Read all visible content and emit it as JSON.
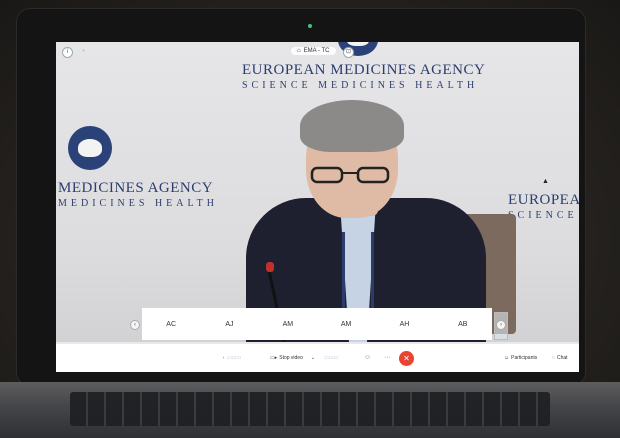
{
  "meeting": {
    "title": "EMA - TC",
    "lock_icon": "lock-icon"
  },
  "backdrop": {
    "org_name": "EUROPEAN MEDICINES AGENCY",
    "tagline": "SCIENCE MEDICINES HEALTH",
    "left_name": "MEDICINES AGENCY",
    "left_tagline": "MEDICINES HEALTH",
    "right_name": "EUROPEAN",
    "right_tagline": "SCIENCE"
  },
  "participants": [
    {
      "initials": "AC"
    },
    {
      "initials": "AJ"
    },
    {
      "initials": "AM"
    },
    {
      "initials": "AM"
    },
    {
      "initials": "AH"
    },
    {
      "initials": "AB"
    }
  ],
  "controls": {
    "stop_video": "Stop video",
    "participants": "Participants",
    "chat": "Chat"
  },
  "colors": {
    "end_call": "#e8442f",
    "agency_blue": "#2c3e6e",
    "status_light": "#3ec57a"
  }
}
